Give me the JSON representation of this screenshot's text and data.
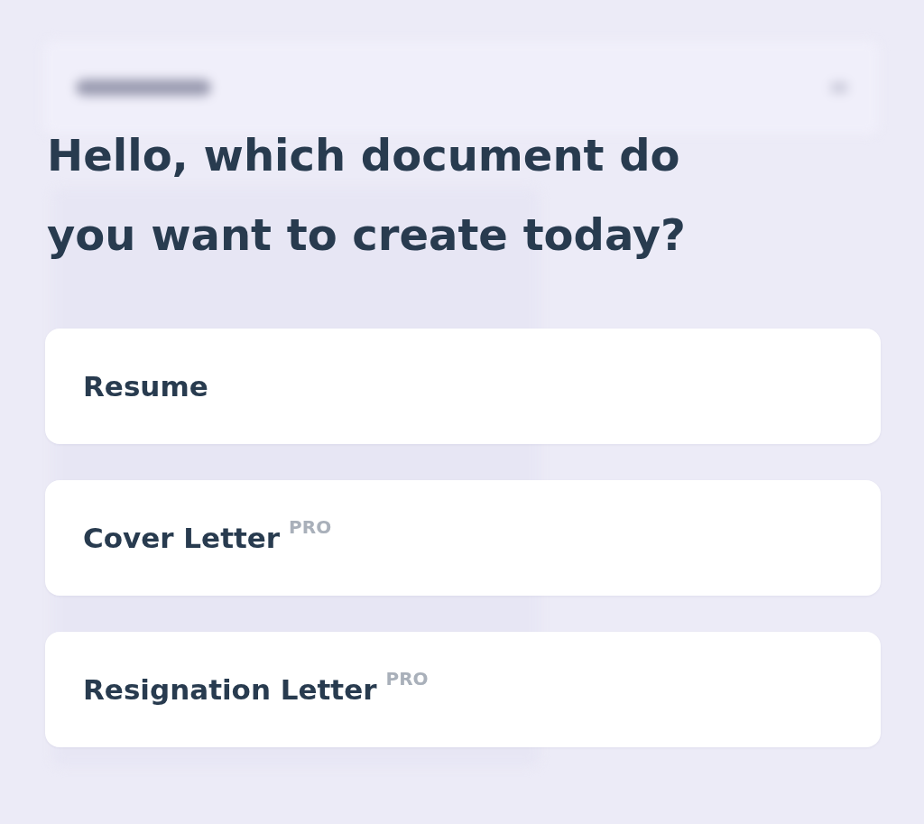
{
  "heading": "Hello, which document do you want to create today?",
  "options": [
    {
      "label": "Resume"
    },
    {
      "label": "Cover Letter",
      "badge": "PRO"
    },
    {
      "label": "Resignation Letter",
      "badge": "PRO"
    }
  ]
}
